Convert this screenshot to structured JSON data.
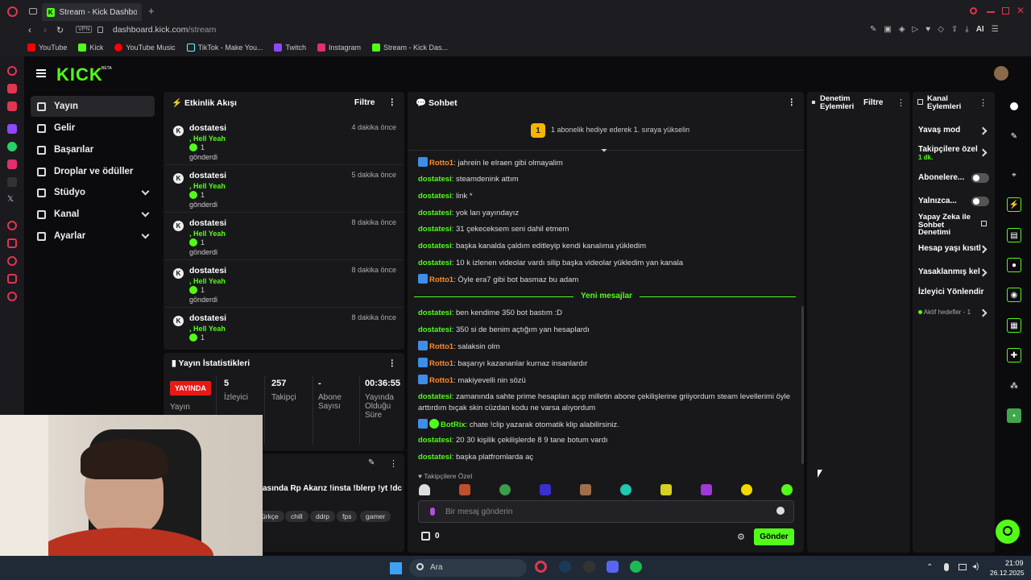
{
  "browser": {
    "tab_title": "Stream - Kick Dashboard",
    "url_domain": "dashboard.kick.com",
    "url_path": "/stream",
    "vpn": "VPN",
    "ai": "AI",
    "bookmarks": [
      "YouTube",
      "Kick",
      "YouTube Music",
      "TikTok - Make You...",
      "Twitch",
      "Instagram",
      "Stream - Kick Das..."
    ]
  },
  "app": {
    "logo": "KICK",
    "beta": "BETA",
    "nav": [
      "Yayın",
      "Gelir",
      "Başarılar",
      "Droplar ve ödüller",
      "Stüdyo",
      "Kanal",
      "Ayarlar"
    ]
  },
  "activity": {
    "title": "Etkinlik Akışı",
    "filter": "Filtre",
    "items": [
      {
        "user": "dostatesi",
        "time": "4 dakika önce",
        "gift": ", Hell Yeah",
        "count": "1",
        "sent": "gönderdi"
      },
      {
        "user": "dostatesi",
        "time": "5 dakika önce",
        "gift": ", Hell Yeah",
        "count": "1",
        "sent": "gönderdi"
      },
      {
        "user": "dostatesi",
        "time": "8 dakika önce",
        "gift": ", Hell Yeah",
        "count": "1",
        "sent": "gönderdi"
      },
      {
        "user": "dostatesi",
        "time": "8 dakika önce",
        "gift": ", Hell Yeah",
        "count": "1",
        "sent": "gönderdi"
      },
      {
        "user": "dostatesi",
        "time": "8 dakika önce",
        "gift": ", Hell Yeah",
        "count": "1",
        "sent": ""
      }
    ]
  },
  "stats": {
    "title": "Yayın İstatistikleri",
    "live": "YAYINDA",
    "live_label": "Yayın",
    "viewers": "5",
    "viewers_label": "İzleyici",
    "followers": "257",
    "followers_label": "Takipçi",
    "subs": "-",
    "subs_label": "Abone Sayısı",
    "duration": "00:36:55",
    "duration_label": "Yayında Olduğu Süre"
  },
  "streaminfo": {
    "title_text": "asında Rp Akarız !insta !blerp !yt !dc",
    "tags": [
      "ürkçe",
      "chill",
      "ddrp",
      "fps",
      "gamer"
    ]
  },
  "chat": {
    "title": "Sohbet",
    "gift_rank": "1",
    "gift_banner": "1 abonelik hediye ederek 1. sıraya yükselin",
    "new_messages": "Yeni mesajlar",
    "messages": [
      {
        "user": "Rotto1",
        "text": ": jahrein le elraen gibi olmayalim"
      },
      {
        "user": "dostatesi",
        "text": ": steamdenink attım"
      },
      {
        "user": "dostatesi",
        "text": ": link *"
      },
      {
        "user": "dostatesi",
        "text": ": yok lan yayındayız"
      },
      {
        "user": "dostatesi",
        "text": ": 31 çekeceksem seni dahil etmem"
      },
      {
        "user": "dostatesi",
        "text": ": başka kanalda çaldım editleyip kendi kanalıma yükledim"
      },
      {
        "user": "dostatesi",
        "text": ": 10 k izlenen videolar vardı silip başka videolar yükledim yan kanala"
      },
      {
        "user": "Rotto1",
        "text": ": Öyle era7 gibi bot basmaz bu adam"
      },
      {
        "user": "dostatesi",
        "text": ": ben kendime 350 bot bastım :D"
      },
      {
        "user": "dostatesi",
        "text": ": 350 si de benim açtığım yan hesaplardı"
      },
      {
        "user": "Rotto1",
        "text": ": salaksin olm"
      },
      {
        "user": "Rotto1",
        "text": ": başarıyı kazananlar kurnaz insanlardır"
      },
      {
        "user": "Rotto1",
        "text": ": makiyevelli nin sözü"
      },
      {
        "user": "dostatesi",
        "text": ": zamanında sahte prime hesapları açıp milletin abone çekilişlerine griiyordum steam levellerimi öyle arttırdım bıçak skin cüzdan kodu ne varsa alıyordum"
      },
      {
        "user": "BotRix",
        "text": ": chate !clip yazarak otomatik klip alabilirsiniz."
      },
      {
        "user": "dostatesi",
        "text": ": 20 30 kişilik çekilişlerde 8 9 tane botum vardı"
      },
      {
        "user": "dostatesi",
        "text": ": başka platfromlarda aç"
      }
    ],
    "followers_only": "Takipçilere Özel",
    "input_placeholder": "Bir mesaj gönderin",
    "points": "0",
    "send": "Gönder"
  },
  "moderation": {
    "title": "Denetim Eylemleri",
    "filter": "Filtre"
  },
  "channel_actions": {
    "title": "Kanal Eylemleri",
    "slow": "Yavaş mod",
    "followers": "Takipçilere özel",
    "followers_sub": "1 dk.",
    "subs": "Abonelere...",
    "only": "Yalnızca...",
    "ai": "Yapay Zeka ile Sohbet Denetimi",
    "age": "Hesap yaşı kısıtl",
    "banned": "Yasaklanmış kel",
    "viewer_dir": "İzleyici Yönlendir",
    "goals": "Aktif hedefler - 1"
  },
  "taskbar": {
    "search": "Ara",
    "time": "21:09",
    "date": "26.12.2025"
  }
}
